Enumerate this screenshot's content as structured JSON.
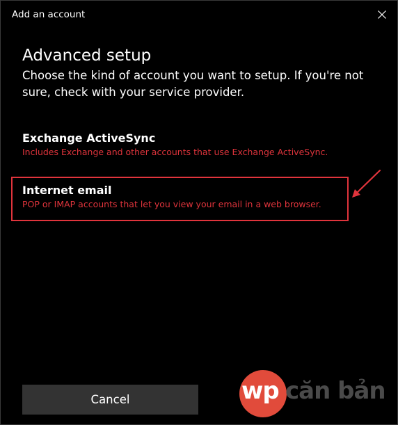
{
  "window": {
    "title": "Add an account"
  },
  "main": {
    "heading": "Advanced setup",
    "description": "Choose the kind of account you want to setup. If you're not sure, check with your service provider."
  },
  "options": [
    {
      "title": "Exchange ActiveSync",
      "description": "Includes Exchange and other accounts that use Exchange ActiveSync."
    },
    {
      "title": "Internet email",
      "description": "POP or IMAP accounts that let you view your email in a web browser.",
      "highlighted": true
    }
  ],
  "footer": {
    "cancel_label": "Cancel"
  },
  "watermark": {
    "logo_text_wp": "wp",
    "logo_text_rest": "căn bản"
  },
  "colors": {
    "background": "#000000",
    "accent_red": "#e0343c",
    "button_bg": "#333333",
    "text": "#ffffff"
  },
  "icons": {
    "close": "close-icon",
    "annotation_arrow": "red-arrow-annotation"
  }
}
